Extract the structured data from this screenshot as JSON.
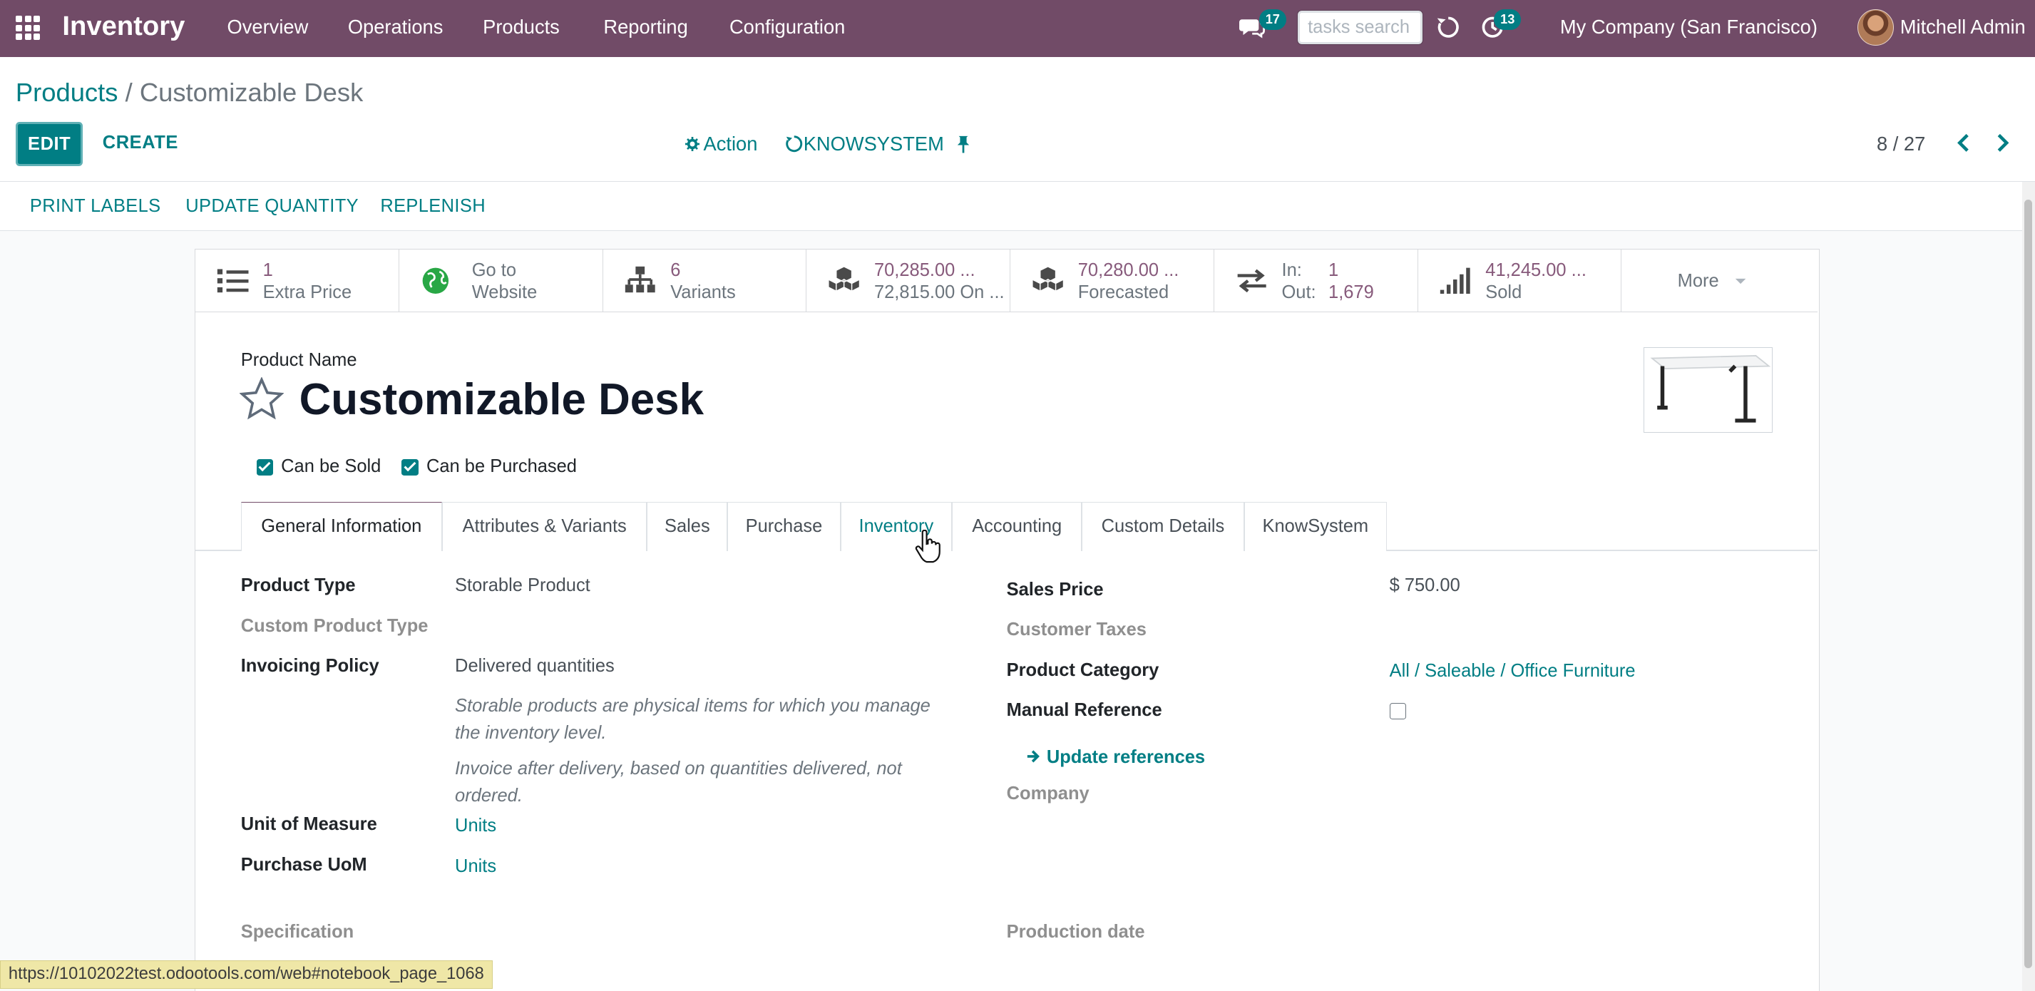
{
  "navbar": {
    "brand": "Inventory",
    "menu": [
      "Overview",
      "Operations",
      "Products",
      "Reporting",
      "Configuration"
    ],
    "messages_badge": "17",
    "tasks_search_placeholder": "tasks search",
    "activities_badge": "13",
    "company": "My Company (San Francisco)",
    "user": "Mitchell Admin"
  },
  "breadcrumb": {
    "parent": "Products",
    "separator": "/",
    "current": "Customizable Desk"
  },
  "control": {
    "edit_label": "EDIT",
    "create_label": "CREATE",
    "action_label": "Action",
    "knowsystem_label": "KNOWSYSTEM",
    "pager": "8 / 27"
  },
  "statusbar": [
    "PRINT LABELS",
    "UPDATE QUANTITY",
    "REPLENISH"
  ],
  "smart_buttons": [
    {
      "v1": "1",
      "v2": "Extra Price",
      "icon": "list-icon"
    },
    {
      "v1": "Go to",
      "v2": "Website",
      "icon": "globe-icon"
    },
    {
      "v1": "6",
      "v2": "Variants",
      "icon": "sitemap-icon"
    },
    {
      "v1": "70,285.00 ...",
      "v2": "72,815.00 On ...",
      "icon": "cubes-icon"
    },
    {
      "v1": "70,280.00 ...",
      "v2": "Forecasted",
      "icon": "cubes-icon"
    },
    {
      "v1": "In:",
      "v1b": "1",
      "v2": "Out:",
      "v2b": "1,679",
      "icon": "exchange-icon"
    },
    {
      "v1": "41,245.00 ...",
      "v2": "Sold",
      "icon": "signal-icon"
    }
  ],
  "more_label": "More",
  "product": {
    "name_label": "Product Name",
    "name": "Customizable Desk",
    "can_be_sold": "Can be Sold",
    "can_be_purchased": "Can be Purchased"
  },
  "tabs": [
    "General Information",
    "Attributes & Variants",
    "Sales",
    "Purchase",
    "Inventory",
    "Accounting",
    "Custom Details",
    "KnowSystem"
  ],
  "left_fields": {
    "product_type_label": "Product Type",
    "product_type": "Storable Product",
    "custom_product_type_label": "Custom Product Type",
    "invoicing_policy_label": "Invoicing Policy",
    "invoicing_policy": "Delivered quantities",
    "help1_line1": "Storable products are physical items for which you manage",
    "help1_line2": "the inventory level.",
    "help2_line1": "Invoice after delivery, based on quantities delivered, not",
    "help2_line2": "ordered.",
    "uom_label": "Unit of Measure",
    "uom": "Units",
    "purchase_uom_label": "Purchase UoM",
    "purchase_uom": "Units",
    "specification_label": "Specification"
  },
  "right_fields": {
    "sales_price_label": "Sales Price",
    "sales_price": "$ 750.00",
    "customer_taxes_label": "Customer Taxes",
    "product_category_label": "Product Category",
    "product_category": "All / Saleable / Office Furniture",
    "manual_reference_label": "Manual Reference",
    "update_references": "Update references",
    "company_label": "Company",
    "production_date_label": "Production date"
  },
  "status_url": "https://10102022test.odootools.com/web#notebook_page_1068",
  "colors": {
    "navbar": "#714b67",
    "accent": "#017e84",
    "smart_value": "#875a7b"
  }
}
